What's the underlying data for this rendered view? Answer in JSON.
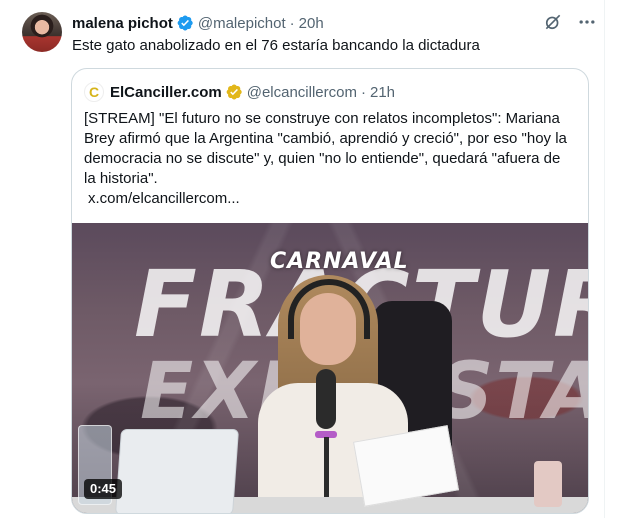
{
  "tweet": {
    "display_name": "malena pichot",
    "handle": "@malepichot",
    "separator": "·",
    "time": "20h",
    "text": "Este gato anabolizado en el 76 estaría bancando la dictadura"
  },
  "quote": {
    "avatar_letter": "C",
    "display_name": "ElCanciller.com",
    "handle": "@elcancillercom",
    "separator": "·",
    "time": "21h",
    "text_lines": [
      "[STREAM] \"El futuro no se construye con relatos incompletos\": Mariana",
      "Brey afirmó que la Argentina \"cambió, aprendió y creció\", por eso \"hoy la",
      "democracia no se discute\" y, quien \"no lo entiende\", quedará \"afuera de",
      "la historia\"."
    ],
    "link": "x.com/elcancillercom...",
    "media": {
      "logo_text": "CARNAVAL",
      "bg_text_top": "FRACTURA",
      "bg_text_bottom": "EXPUESTA",
      "duration": "0:45"
    }
  },
  "colors": {
    "verified_blue": "#1d9bf0",
    "verified_gold": "#e2b719",
    "text_primary": "#0f1419",
    "text_secondary": "#536471",
    "border": "#cfd9de"
  },
  "icons": {
    "verified": "verified-badge-icon",
    "gold_verified": "gold-verified-badge-icon",
    "grok": "grok-icon",
    "more": "more-horizontal-icon"
  }
}
